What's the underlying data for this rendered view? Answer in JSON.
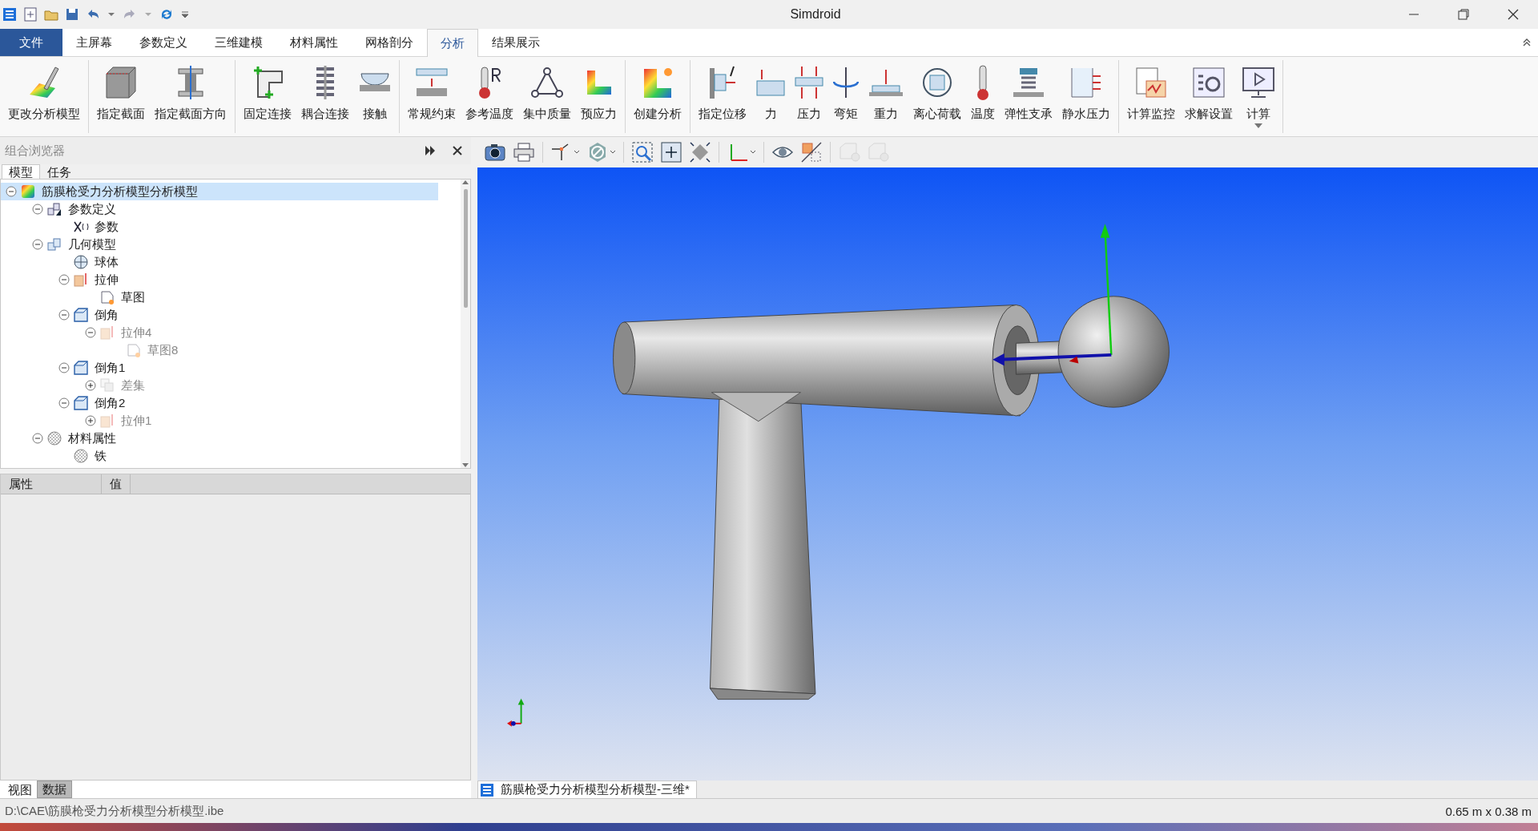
{
  "window": {
    "title": "Simdroid"
  },
  "ribbon_tabs": [
    {
      "label": "文件",
      "kind": "file",
      "selected": false
    },
    {
      "label": "主屏幕",
      "kind": "tab",
      "selected": false
    },
    {
      "label": "参数定义",
      "kind": "tab",
      "selected": false
    },
    {
      "label": "三维建模",
      "kind": "tab",
      "selected": false
    },
    {
      "label": "材料属性",
      "kind": "tab",
      "selected": false
    },
    {
      "label": "网格剖分",
      "kind": "tab",
      "selected": false
    },
    {
      "label": "分析",
      "kind": "tab",
      "selected": true
    },
    {
      "label": "结果展示",
      "kind": "tab",
      "selected": false
    }
  ],
  "ribbon_groups": [
    {
      "buttons": [
        {
          "label": "更改分析模型",
          "kind": "edit-model"
        }
      ]
    },
    {
      "buttons": [
        {
          "label": "指定截面",
          "kind": "section"
        },
        {
          "label": "指定截面方向",
          "kind": "section-direction"
        }
      ]
    },
    {
      "buttons": [
        {
          "label": "固定连接",
          "kind": "fixed-joint"
        },
        {
          "label": "耦合连接",
          "kind": "coupling"
        },
        {
          "label": "接触",
          "kind": "contact"
        }
      ]
    },
    {
      "buttons": [
        {
          "label": "常规约束",
          "kind": "constraint"
        },
        {
          "label": "参考温度",
          "kind": "ref-temp"
        },
        {
          "label": "集中质量",
          "kind": "point-mass"
        },
        {
          "label": "预应力",
          "kind": "prestress"
        }
      ]
    },
    {
      "buttons": [
        {
          "label": "创建分析",
          "kind": "create-analysis"
        }
      ]
    },
    {
      "buttons": [
        {
          "label": "指定位移",
          "kind": "displacement"
        },
        {
          "label": "力",
          "kind": "force"
        },
        {
          "label": "压力",
          "kind": "pressure"
        },
        {
          "label": "弯矩",
          "kind": "moment"
        },
        {
          "label": "重力",
          "kind": "gravity"
        },
        {
          "label": "离心荷载",
          "kind": "centrifugal"
        },
        {
          "label": "温度",
          "kind": "temperature"
        },
        {
          "label": "弹性支承",
          "kind": "elastic-support"
        },
        {
          "label": "静水压力",
          "kind": "hydrostatic"
        }
      ]
    },
    {
      "buttons": [
        {
          "label": "计算监控",
          "kind": "monitor"
        },
        {
          "label": "求解设置",
          "kind": "solver-settings"
        },
        {
          "label": "计算",
          "kind": "compute",
          "dropdown": true
        }
      ]
    }
  ],
  "browser": {
    "title": "组合浏览器",
    "tabs": [
      {
        "label": "模型",
        "selected": true
      },
      {
        "label": "任务",
        "selected": false
      }
    ],
    "tree": [
      {
        "label": "筋膜枪受力分析模型分析模型",
        "kind": "analysis",
        "selected": true,
        "expanded": true,
        "dimmed": false,
        "children": [
          {
            "label": "参数定义",
            "kind": "params",
            "selected": false,
            "expanded": true,
            "dimmed": false,
            "children": [
              {
                "label": "参数",
                "kind": "variable",
                "selected": false,
                "dimmed": false
              }
            ]
          },
          {
            "label": "几何模型",
            "kind": "geometry",
            "selected": false,
            "expanded": true,
            "dimmed": false,
            "children": [
              {
                "label": "球体",
                "kind": "sphere",
                "selected": false,
                "dimmed": false
              },
              {
                "label": "拉伸",
                "kind": "extrude",
                "selected": false,
                "expanded": true,
                "dimmed": false,
                "children": [
                  {
                    "label": "草图",
                    "kind": "sketch",
                    "selected": false,
                    "dimmed": false
                  }
                ]
              },
              {
                "label": "倒角",
                "kind": "chamfer",
                "selected": false,
                "expanded": true,
                "dimmed": false,
                "children": [
                  {
                    "label": "拉伸4",
                    "kind": "extrude",
                    "selected": false,
                    "expanded": true,
                    "dimmed": true,
                    "children": [
                      {
                        "label": "草图8",
                        "kind": "sketch",
                        "selected": false,
                        "dimmed": true
                      }
                    ]
                  }
                ]
              },
              {
                "label": "倒角1",
                "kind": "chamfer",
                "selected": false,
                "expanded": true,
                "dimmed": false,
                "children": [
                  {
                    "label": "差集",
                    "kind": "boolean",
                    "selected": false,
                    "expanded": false,
                    "dimmed": true
                  }
                ]
              },
              {
                "label": "倒角2",
                "kind": "chamfer",
                "selected": false,
                "expanded": true,
                "dimmed": false,
                "children": [
                  {
                    "label": "拉伸1",
                    "kind": "extrude",
                    "selected": false,
                    "expanded": false,
                    "dimmed": true
                  }
                ]
              }
            ]
          },
          {
            "label": "材料属性",
            "kind": "material",
            "selected": false,
            "expanded": true,
            "dimmed": false,
            "children": [
              {
                "label": "铁",
                "kind": "material",
                "selected": false,
                "dimmed": false
              }
            ]
          }
        ]
      }
    ]
  },
  "properties": {
    "columns": [
      "属性",
      "值"
    ]
  },
  "bottom_tabs": [
    {
      "label": "视图",
      "selected": false
    },
    {
      "label": "数据",
      "selected": true
    }
  ],
  "viewport_toolbar": [
    {
      "kind": "camera",
      "dropdown": false,
      "disabled": false
    },
    {
      "kind": "print",
      "dropdown": false,
      "disabled": false
    },
    {
      "kind": "pick",
      "dropdown": true,
      "disabled": false
    },
    {
      "kind": "hide",
      "dropdown": true,
      "disabled": false
    },
    {
      "kind": "zoom-box",
      "dropdown": false,
      "disabled": false
    },
    {
      "kind": "pan",
      "dropdown": false,
      "disabled": false
    },
    {
      "kind": "fit",
      "dropdown": false,
      "disabled": false
    },
    {
      "kind": "axes",
      "dropdown": true,
      "disabled": false
    },
    {
      "kind": "view",
      "dropdown": false,
      "disabled": false
    },
    {
      "kind": "section-plane",
      "dropdown": false,
      "disabled": false
    },
    {
      "kind": "light",
      "dropdown": false,
      "disabled": true
    },
    {
      "kind": "light",
      "dropdown": false,
      "disabled": true
    }
  ],
  "document_tab": {
    "label": "筋膜枪受力分析模型分析模型-三维*"
  },
  "status_bar": {
    "path": "D:\\CAE\\筋膜枪受力分析模型分析模型.ibe",
    "dimensions": "0.65 m x 0.38 m"
  }
}
